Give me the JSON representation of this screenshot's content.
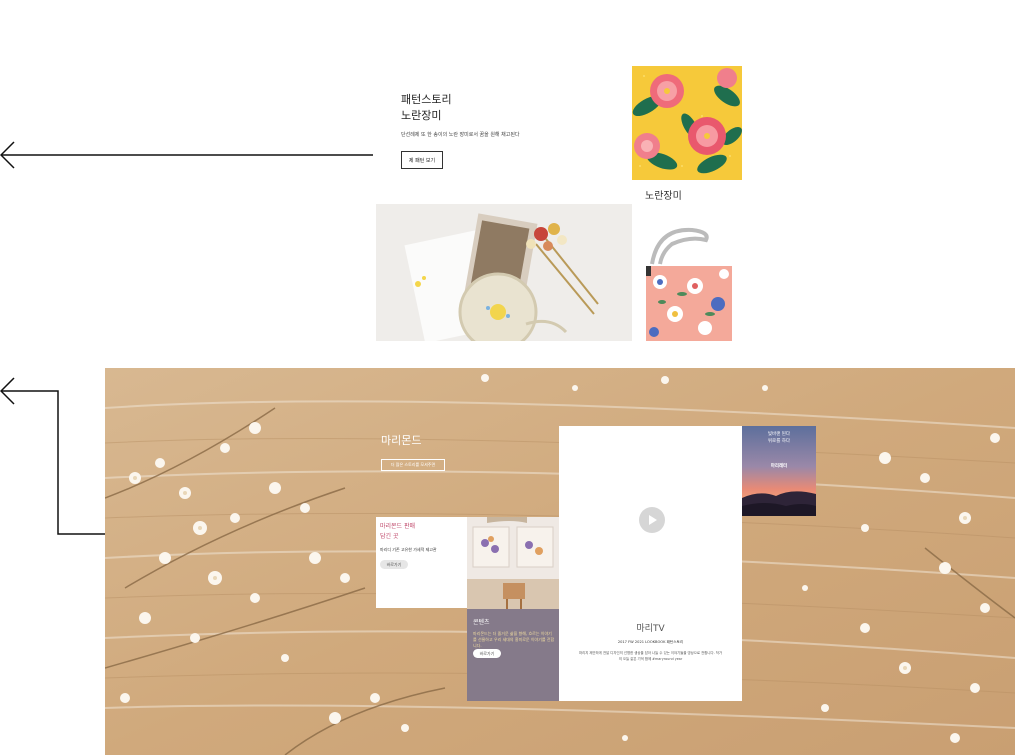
{
  "pattern_story": {
    "title_line1": "패턴스토리",
    "title_line2": "노란장미",
    "description": "단선례제 또 한 송이의 노란 장미로서 꿈을 원해 채고된다",
    "button_label": "제 패턴 보기",
    "caption": "노란장미"
  },
  "maryround": {
    "title": "마리몬드",
    "button_label": "더 많은 스토리를 모셔주면"
  },
  "card_sale": {
    "title_line1": "마리몬드 판매",
    "title_line2": "담긴 곳",
    "description": "마리디 기존 고유한 가세적 제고관",
    "button_label": "바로가기"
  },
  "card_contents": {
    "title": "콘텐츠",
    "description": "마리몬드는 더 즐거운 삶을 향해, 흐르는 이야기를 선물하고 우리 세대의 흥미로운 이야기를 전합니다.",
    "button_label": "바로가기"
  },
  "card_tv": {
    "title": "마리TV",
    "subtitle": "2017 FW 2021 LOOKBOOK 패턴스토리",
    "description": "마리지 제안하게 전달 디자인의 선명한 생상을 담아 나눌 수 있는 이야기들을 영상으로 전합니다. 작가의 오늘 같은 기억 함께 #maryround year"
  },
  "card_sunset": {
    "text_line1": "빛바랜 된다",
    "text_line2": "위로를 하다",
    "label": "마리레터"
  },
  "colors": {
    "purple_card": "#857a8a",
    "accent_pink": "#c0486a",
    "wood": "#d2ad82"
  },
  "icons": [
    "arrow-left-icon",
    "play-icon"
  ]
}
